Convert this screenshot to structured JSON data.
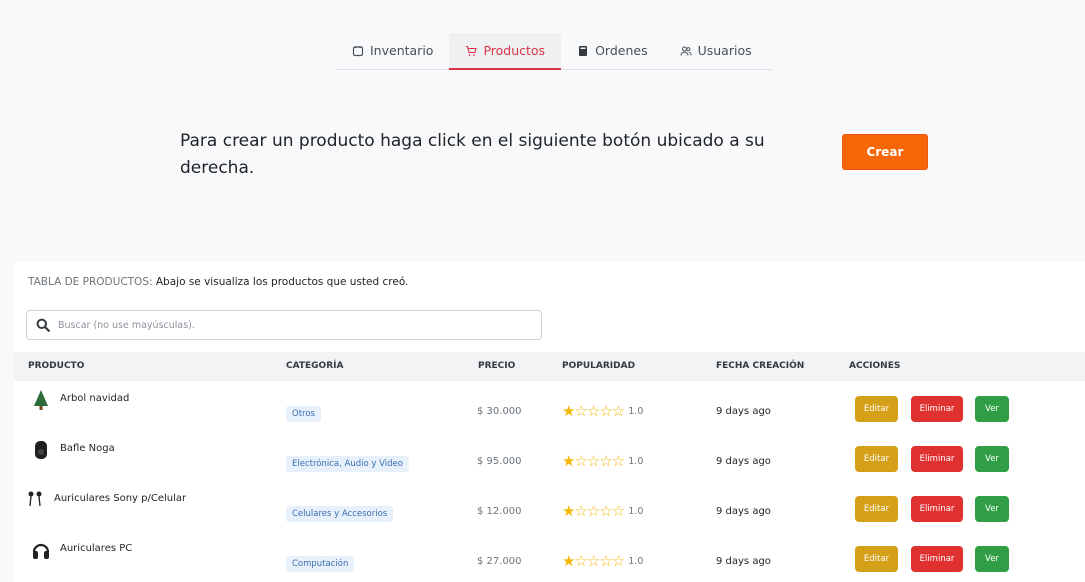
{
  "tabs": [
    {
      "label": "Inventario",
      "icon": "inventory-icon"
    },
    {
      "label": "Productos",
      "icon": "cart-icon",
      "active": true
    },
    {
      "label": "Ordenes",
      "icon": "book-icon"
    },
    {
      "label": "Usuarios",
      "icon": "users-icon"
    }
  ],
  "intro": {
    "text": "Para crear un producto haga click en el siguiente botón ubicado a su derecha.",
    "create_label": "Crear"
  },
  "table": {
    "title_prefix": "TABLA DE PRODUCTOS:",
    "title_rest": " Abajo se visualiza los productos que usted creó.",
    "search_placeholder": "Buscar (no use mayúsculas).",
    "headers": [
      "PRODUCTO",
      "CATEGORÍA",
      "PRECIO",
      "POPULARIDAD",
      "FECHA CREACIÓN",
      "ACCIONES"
    ],
    "rows": [
      {
        "name": "Arbol navidad",
        "category": "Otros",
        "price": "$ 30.000",
        "rating": "1.0",
        "date": "9 days ago"
      },
      {
        "name": "Bafle Noga",
        "category": "Electrónica, Audio y Video",
        "price": "$ 95.000",
        "rating": "1.0",
        "date": "9 days ago"
      },
      {
        "name": "Auriculares Sony p/Celular",
        "category": "Celulares y Accesorios",
        "price": "$ 12.000",
        "rating": "1.0",
        "date": "9 days ago"
      },
      {
        "name": "Auriculares PC",
        "category": "Computación",
        "price": "$ 27.000",
        "rating": "1.0",
        "date": "9 days ago"
      }
    ],
    "actions": {
      "edit": "Editar",
      "delete": "Eliminar",
      "view": "Ver"
    }
  },
  "colors": {
    "accent": "#dc3545",
    "create": "#f76707",
    "edit": "#d4a017",
    "delete": "#e03131",
    "view": "#2f9e44",
    "star": "#f2b705"
  }
}
